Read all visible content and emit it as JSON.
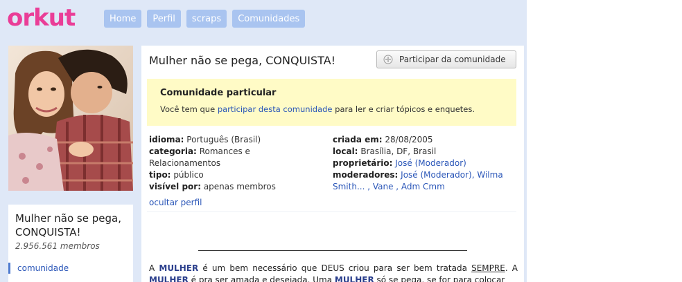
{
  "brand": {
    "logo_text": "orkut"
  },
  "nav": {
    "items": [
      {
        "label": "Home"
      },
      {
        "label": "Perfil"
      },
      {
        "label": "scraps"
      },
      {
        "label": "Comunidades"
      }
    ]
  },
  "sidebar": {
    "community_name": "Mulher não se pega, CONQUISTA!",
    "members": "2.956.561 membros",
    "link_label": "comunidade"
  },
  "main": {
    "title": "Mulher não se pega, CONQUISTA!",
    "join_button": "Participar da comunidade",
    "notice": {
      "title": "Comunidade particular",
      "text_before": "Você tem que ",
      "link_text": "participar desta comunidade",
      "text_after": " para ler e criar tópicos e enquetes."
    },
    "info_left": {
      "idioma_label": "idioma:",
      "idioma_value": "Português (Brasil)",
      "categoria_label": "categoria:",
      "categoria_value": "Romances e Relacionamentos",
      "tipo_label": "tipo:",
      "tipo_value": "público",
      "visivel_label": "visível por:",
      "visivel_value": "apenas membros"
    },
    "info_right": {
      "criada_label": "criada em:",
      "criada_value": "28/08/2005",
      "local_label": "local:",
      "local_value": "Brasília, DF, Brasil",
      "proprietario_label": "proprietário:",
      "proprietario_value": "José (Moderador)",
      "moderadores_label": "moderadores:",
      "moderadores_value": "José (Moderador), Wilma Smith... , Vane , Adm Cmm"
    },
    "hide_profile": "ocultar perfil",
    "description": {
      "p1": "A ",
      "w1": "MULHER",
      "p2": " é um bem necessário que DEUS criou para ser bem tratada ",
      "w2": "SEMPRE",
      "p3": ". A ",
      "w3": "MULHER",
      "p4": " é pra ser amada e desejada. Uma ",
      "w4": "MULHER",
      "p5": " só se pega, se for para colocar"
    }
  },
  "colors": {
    "brand_pink": "#ea3d97",
    "nav_blue": "#a9c4f0",
    "page_bg": "#dfe8f7",
    "link_blue": "#2a56b8",
    "notice_yellow": "#fffbc6"
  }
}
